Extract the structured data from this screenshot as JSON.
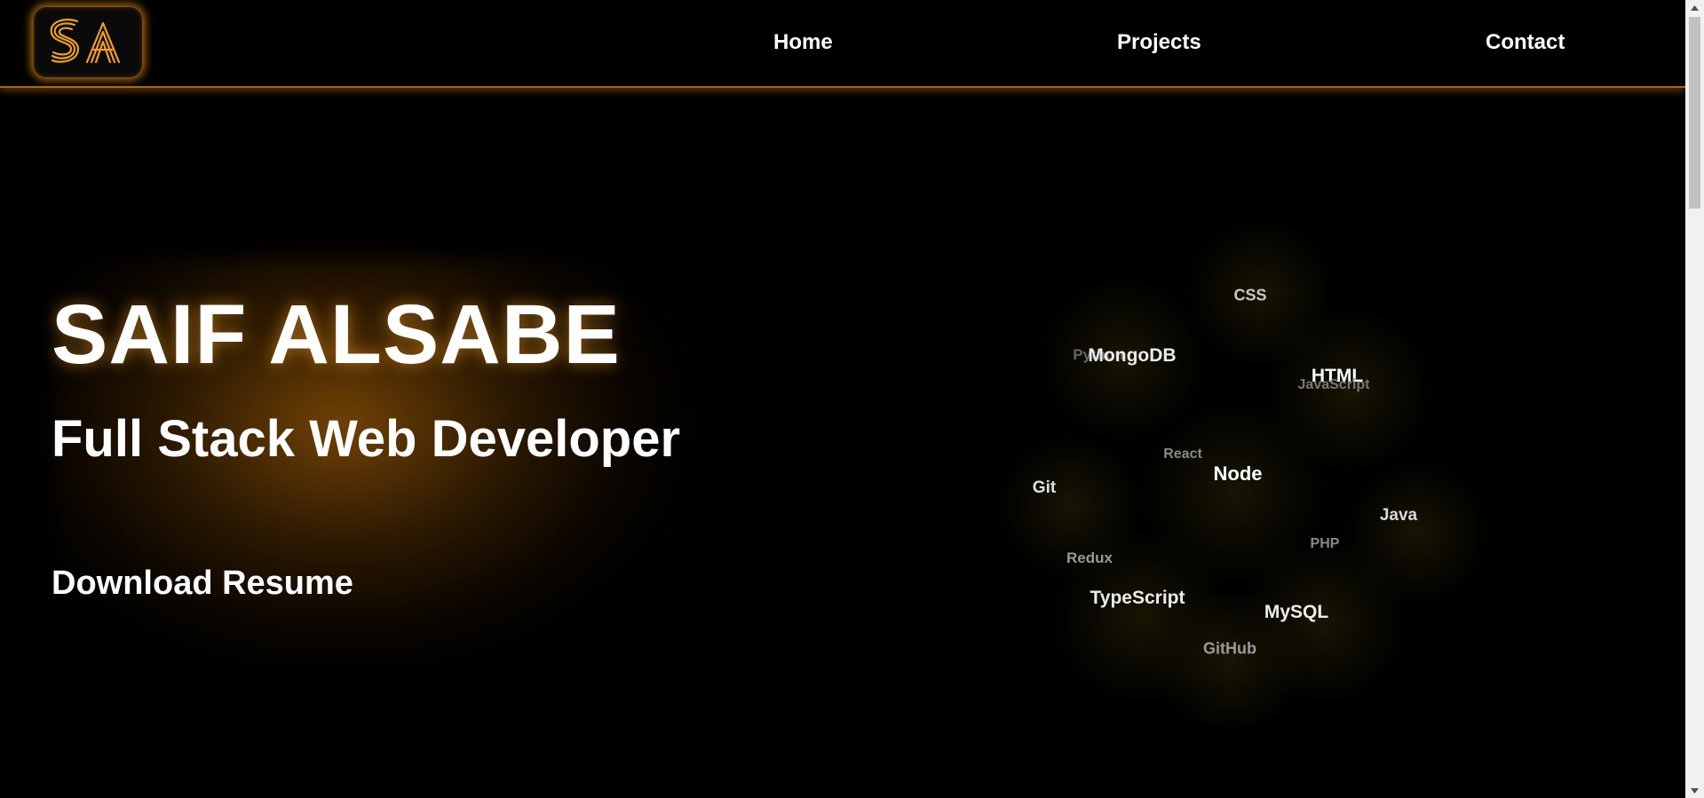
{
  "header": {
    "logo_text": "SA",
    "nav": [
      {
        "label": "Home"
      },
      {
        "label": "Projects"
      },
      {
        "label": "Contact"
      }
    ]
  },
  "hero": {
    "name": "SAIF ALSABE",
    "subtitle": "Full Stack Web Developer",
    "resume_label": "Download Resume"
  },
  "skills": {
    "items": [
      {
        "label": "CSS"
      },
      {
        "label": "Python"
      },
      {
        "label": "MongoDB"
      },
      {
        "label": "HTML"
      },
      {
        "label": "JavaScript"
      },
      {
        "label": "React"
      },
      {
        "label": "Node"
      },
      {
        "label": "Git"
      },
      {
        "label": "Java"
      },
      {
        "label": "PHP"
      },
      {
        "label": "Redux"
      },
      {
        "label": "TypeScript"
      },
      {
        "label": "MySQL"
      },
      {
        "label": "GitHub"
      }
    ]
  },
  "colors": {
    "accent": "#f0a020",
    "background": "#000000",
    "text": "#ffffff"
  },
  "icons": {
    "scroll_up": "triangle-up-icon",
    "scroll_down": "triangle-down-icon"
  }
}
